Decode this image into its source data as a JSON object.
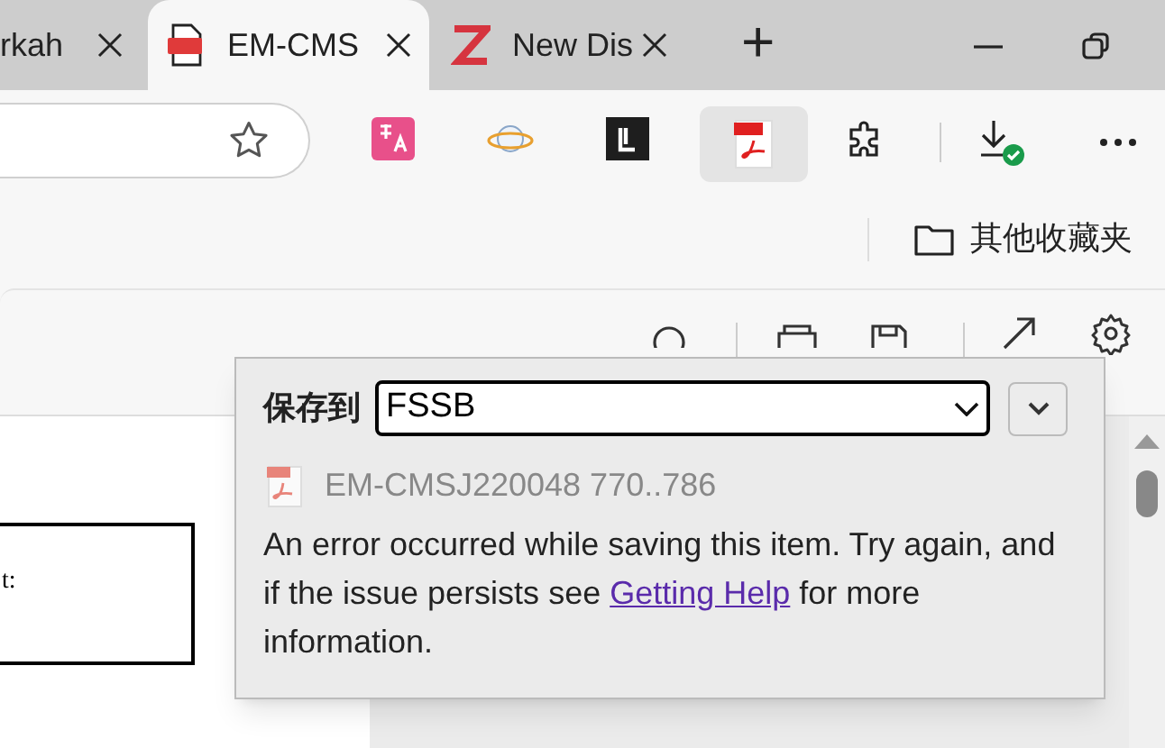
{
  "tabs": [
    {
      "kind": "text",
      "title": "rkah",
      "selected": false
    },
    {
      "kind": "pdf",
      "title": "EM-CMS",
      "selected": true
    },
    {
      "kind": "z",
      "title": "New Dis",
      "selected": false
    }
  ],
  "new_tab": "+",
  "favorites": {
    "folder": "其他收藏夹"
  },
  "document": {
    "box_text": "t:"
  },
  "save_popup": {
    "label": "保存到",
    "target": "FSSB",
    "item_title": "EM-CMSJ220048 770..786",
    "message_before": "An error occurred while saving this item. Try again, and if the issue persists see",
    "link": "Getting Help",
    "message_after": "for more information."
  }
}
